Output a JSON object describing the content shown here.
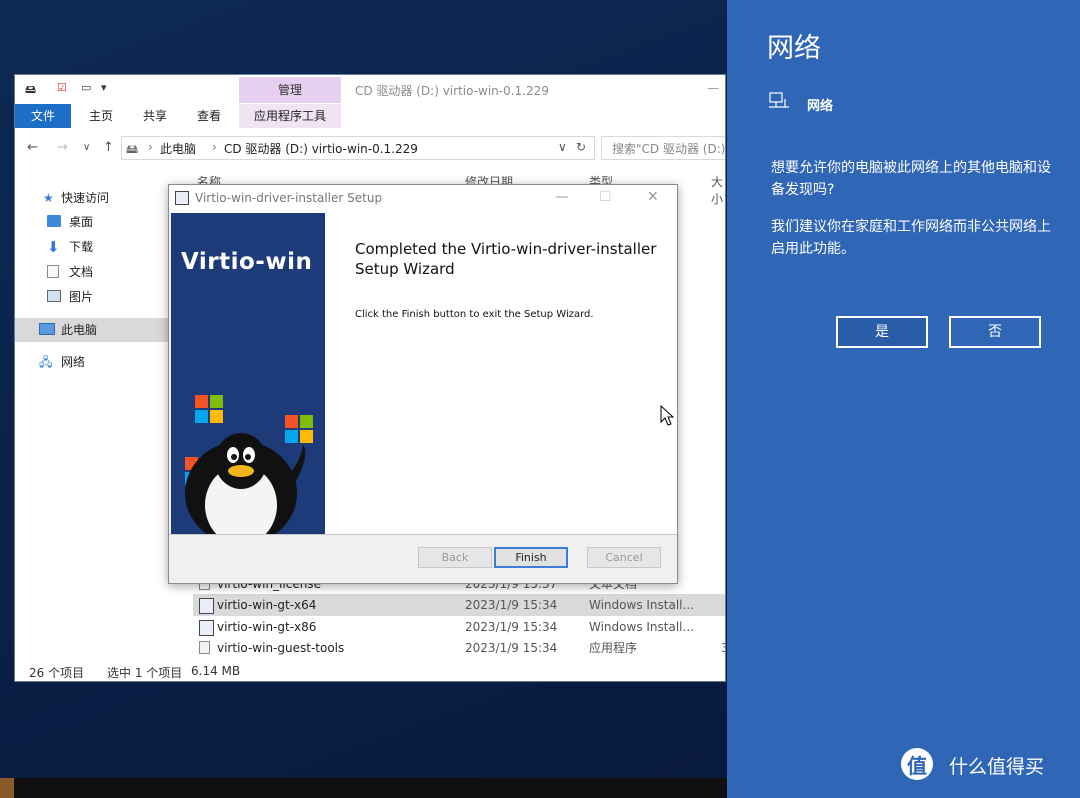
{
  "explorer": {
    "title": "CD 驱动器 (D:) virtio-win-0.1.229",
    "manage_tab": "管理",
    "ribbon_tabs": [
      "文件",
      "主页",
      "共享",
      "查看"
    ],
    "app_tools_tab": "应用程序工具",
    "address_parts": [
      "此电脑",
      "CD 驱动器 (D:) virtio-win-0.1.229"
    ],
    "search_placeholder": "搜索\"CD 驱动器 (D:)",
    "sidebar": [
      {
        "label": "快速访问",
        "icon": "star-icon"
      },
      {
        "label": "桌面",
        "icon": "desktop-icon",
        "pinned": true
      },
      {
        "label": "下载",
        "icon": "download-icon",
        "pinned": true
      },
      {
        "label": "文档",
        "icon": "document-icon",
        "pinned": true
      },
      {
        "label": "图片",
        "icon": "picture-icon",
        "pinned": true
      },
      {
        "label": "此电脑",
        "icon": "computer-icon",
        "selected": true
      },
      {
        "label": "网络",
        "icon": "network-icon"
      }
    ],
    "columns": {
      "name": "名称",
      "date": "修改日期",
      "type": "类型",
      "size": "大小"
    },
    "files": [
      {
        "name": "virtio-win_license",
        "date": "2023/1/9 15:37",
        "type": "文本文档",
        "size": ""
      },
      {
        "name": "virtio-win-gt-x64",
        "date": "2023/1/9 15:34",
        "type": "Windows Install...",
        "size": "",
        "selected": true
      },
      {
        "name": "virtio-win-gt-x86",
        "date": "2023/1/9 15:34",
        "type": "Windows Install...",
        "size": ""
      },
      {
        "name": "virtio-win-guest-tools",
        "date": "2023/1/9 15:34",
        "type": "应用程序",
        "size": "3"
      }
    ],
    "status": {
      "count": "26 个项目",
      "selected": "选中 1 个项目",
      "size": "6.14 MB"
    }
  },
  "dialog": {
    "title": "Virtio-win-driver-installer Setup",
    "brand": "Virtio-win",
    "heading": "Completed the Virtio-win-driver-installer Setup Wizard",
    "body": "Click the Finish button to exit the Setup Wizard.",
    "buttons": {
      "back": "Back",
      "finish": "Finish",
      "cancel": "Cancel"
    }
  },
  "network_panel": {
    "title": "网络",
    "network_name": "网络",
    "question": "想要允许你的电脑被此网络上的其他电脑和设备发现吗?",
    "recommendation": "我们建议你在家庭和工作网络而非公共网络上启用此功能。",
    "yes_label": "是",
    "no_label": "否",
    "accent_color": "#2f66b6"
  },
  "watermark": "什么值得买"
}
